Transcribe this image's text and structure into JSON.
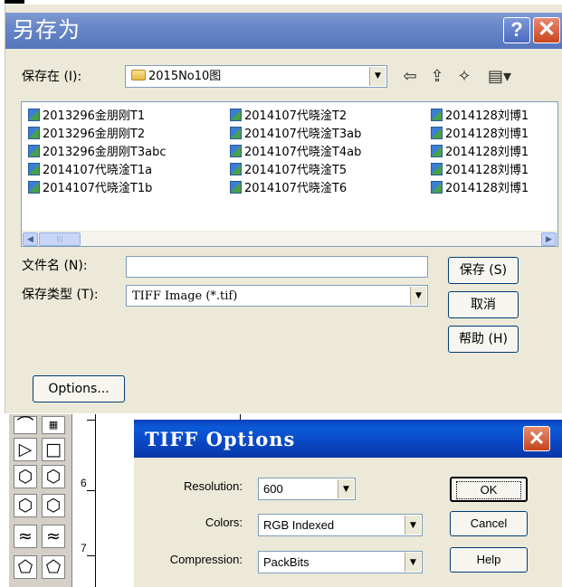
{
  "save_dialog": {
    "title": "另存为",
    "help_btn": "?",
    "close_btn": "✕",
    "save_in_label": "保存在 (I):",
    "folder_value": "2015No10图",
    "nav_icons": [
      "back-arrow-icon",
      "up-folder-icon",
      "new-folder-icon",
      "view-menu-icon"
    ],
    "nav_glyphs": [
      "⇦",
      "⇪",
      "✧",
      "▤▾"
    ],
    "files": [
      "2013296金朋刚T1",
      "2013296金朋刚T2",
      "2013296金朋刚T3abc",
      "2014107代晓淦T1a",
      "2014107代晓淦T1b",
      "2014107代晓淦T2",
      "2014107代晓淦T3ab",
      "2014107代晓淦T4ab",
      "2014107代晓淦T5",
      "2014107代晓淦T6",
      "2014128刘博1",
      "2014128刘博1",
      "2014128刘博1",
      "2014128刘博1",
      "2014128刘博1"
    ],
    "filename_label": "文件名 (N):",
    "filename_value": "",
    "type_label": "保存类型 (T):",
    "type_value": "TIFF Image (*.tif)",
    "save_button": "保存 (S)",
    "cancel_button": "取消",
    "help_button": "帮助 (H)",
    "options_button": "Options..."
  },
  "background": {
    "ruler_numbers": [
      "6",
      "7"
    ],
    "tool_glyphs": [
      "⌒",
      "▷",
      "□",
      "⬡",
      "⬡",
      "⬡",
      "⬡",
      "≈",
      "≈",
      "⬠",
      "⬠"
    ]
  },
  "tiff_dialog": {
    "title": "TIFF Options",
    "close_btn": "✕",
    "resolution_label": "Resolution:",
    "resolution_value": "600",
    "colors_label": "Colors:",
    "colors_value": "RGB Indexed",
    "compression_label": "Compression:",
    "compression_value": "PackBits",
    "ok_button": "OK",
    "cancel_button": "Cancel",
    "help_button": "Help"
  }
}
